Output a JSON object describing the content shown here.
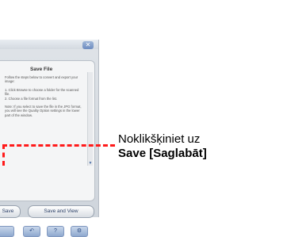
{
  "window": {
    "panel_title": "Save File",
    "instructions": [
      "Follow the steps below to convert and export your image:",
      "1. Click Browse to choose a folder for the scanned file.\n2. Choose a file format from the list.",
      "Note: If you select to save the file in the JPG format, you will see the Quality Option settings in the lower part of the window."
    ],
    "buttons": {
      "save": "Save",
      "save_and_view": "Save and View"
    },
    "toolbar": {
      "back": "↶",
      "help": "?",
      "settings": "⚙"
    },
    "close_glyph": "✕"
  },
  "callout": {
    "line1": "Noklikšķiniet uz",
    "line2": "Save [Saglabāt]",
    "color": "#ff1a1a"
  }
}
